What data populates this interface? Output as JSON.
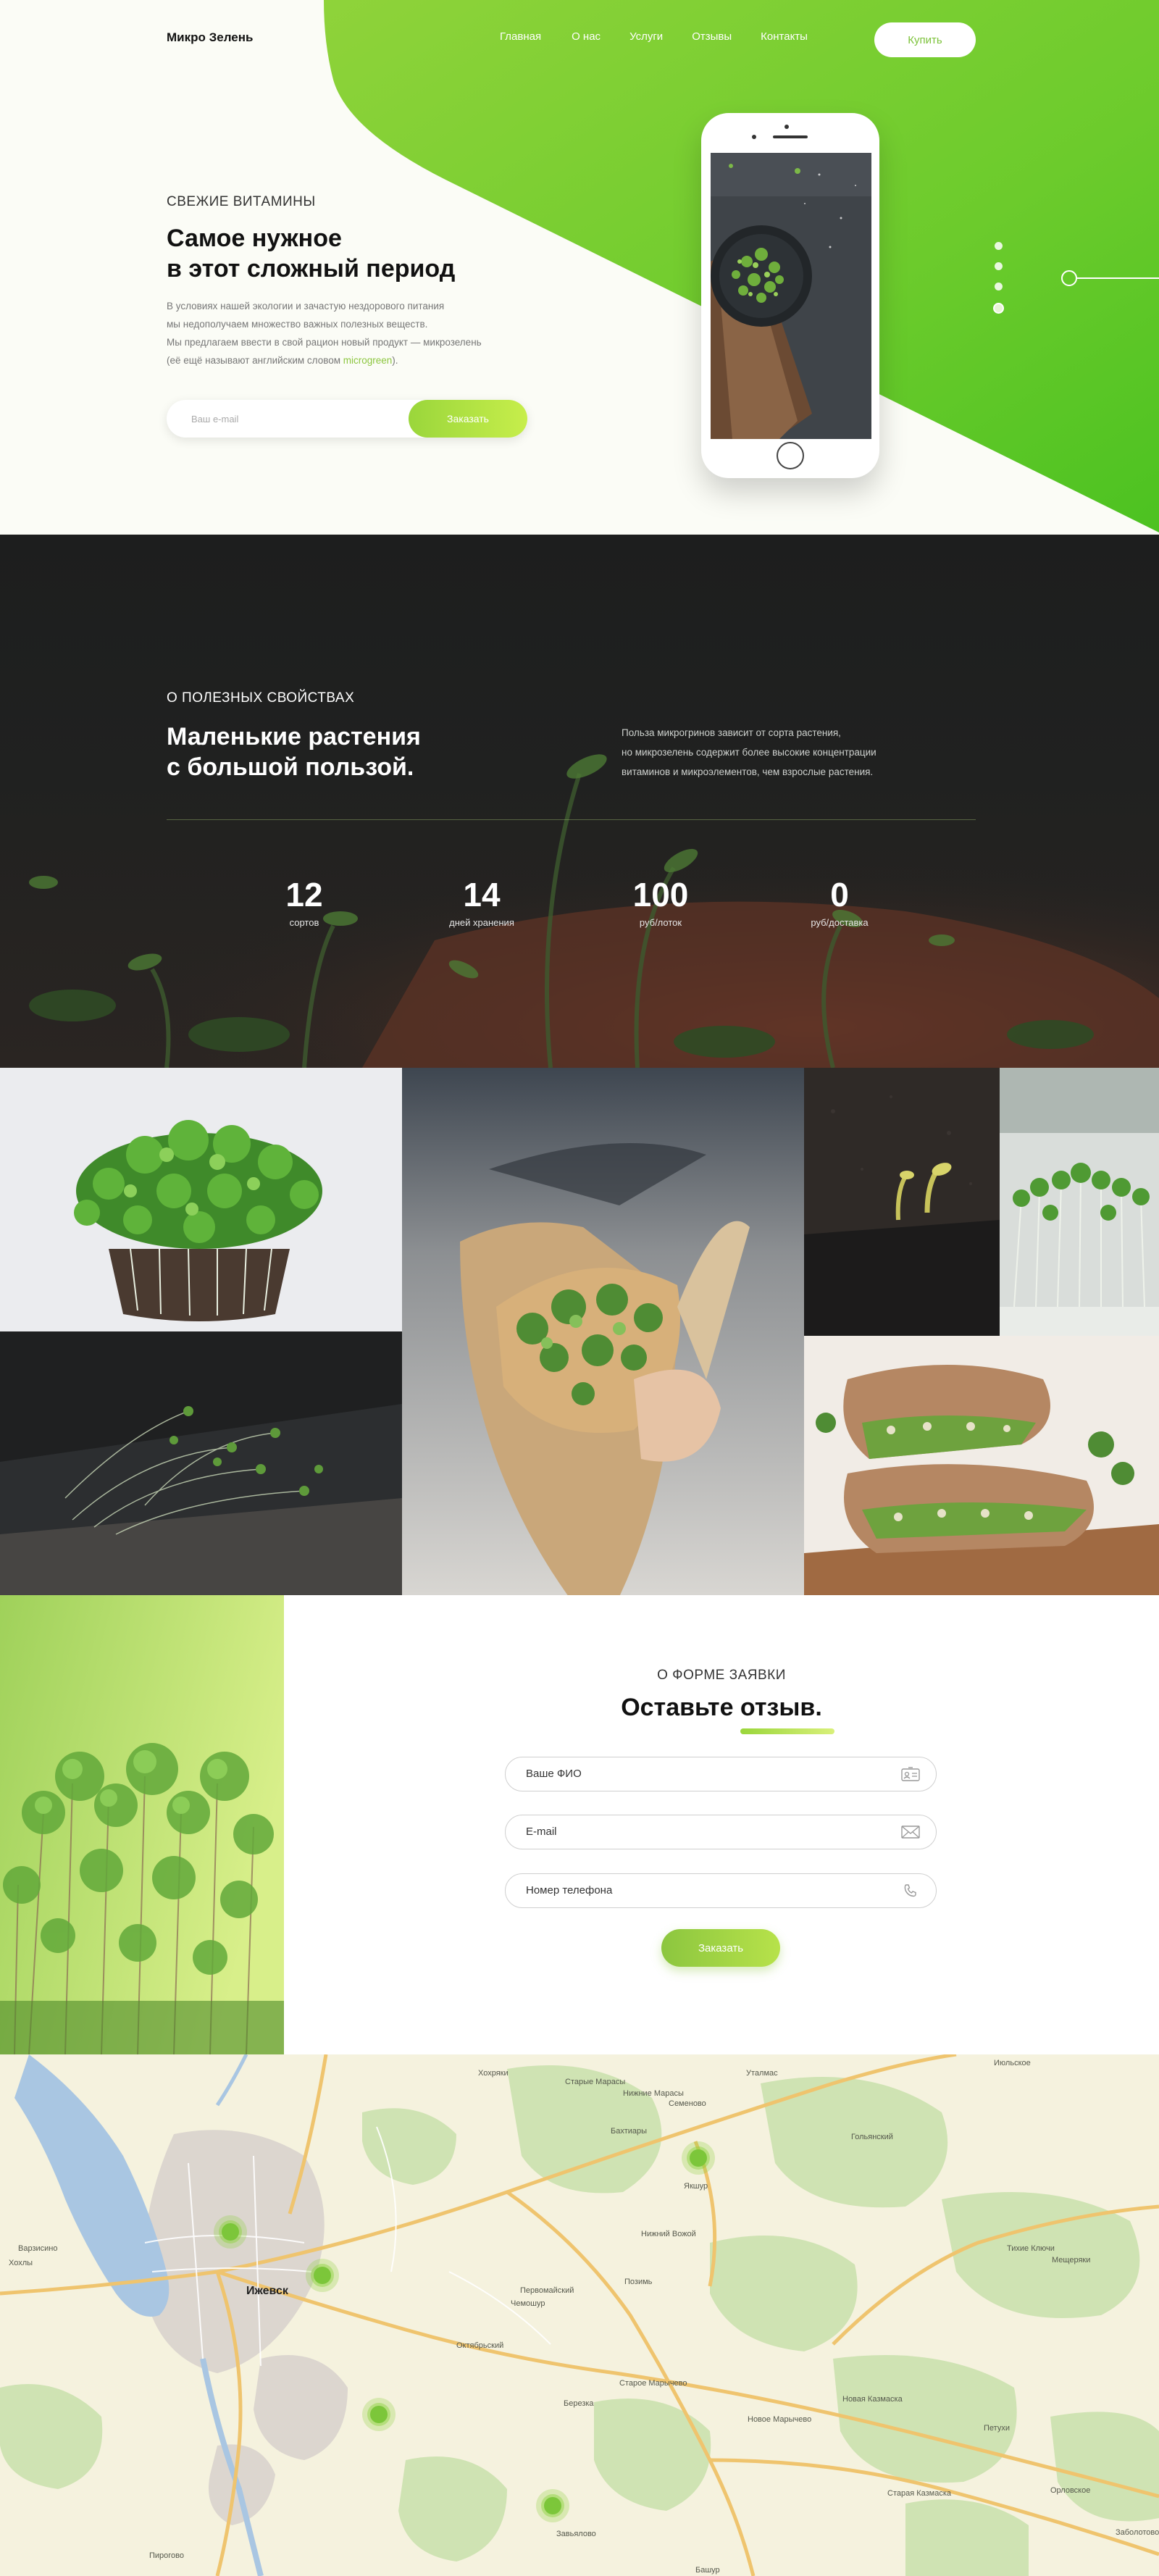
{
  "header": {
    "logo": "Микро Зелень",
    "nav": [
      "Главная",
      "О нас",
      "Услуги",
      "Отзывы",
      "Контакты"
    ],
    "buy_label": "Купить"
  },
  "hero": {
    "eyebrow": "СВЕЖИЕ ВИТАМИНЫ",
    "title_line1": "Самое нужное",
    "title_line2": "в этот сложный период",
    "desc_line1": "В условиях нашей экологии и зачастую нездорового питания",
    "desc_line2": "мы недополучаем множество важных полезных веществ.",
    "desc_line3": "Мы предлагаем ввести в свой рацион новый продукт — микрозелень",
    "desc_line4_prefix": "(её ещё называют английским словом ",
    "desc_line4_highlight": "microgreen",
    "desc_line4_suffix": ").",
    "email_placeholder": "Ваш e-mail",
    "order_label": "Заказать"
  },
  "about": {
    "eyebrow": "О ПОЛЕЗНЫХ СВОЙСТВАХ",
    "title_line1": "Маленькие растения",
    "title_line2": "с большой пользой.",
    "desc_line1": "Польза микрогринов зависит от сорта растения,",
    "desc_line2": "но микрозелень содержит более высокие концентрации",
    "desc_line3": "витаминов и микроэлементов, чем взрослые растения.",
    "stats": [
      {
        "value": "12",
        "label": "сортов"
      },
      {
        "value": "14",
        "label": "дней хранения"
      },
      {
        "value": "100",
        "label": "руб/лоток"
      },
      {
        "value": "0",
        "label": "руб/доставка"
      }
    ]
  },
  "form": {
    "eyebrow": "О ФОРМЕ ЗАЯВКИ",
    "title": "Оставьте отзыв.",
    "name_placeholder": "Ваше ФИО",
    "email_placeholder": "E-mail",
    "phone_placeholder": "Номер телефона",
    "submit_label": "Заказать"
  },
  "map": {
    "labels": [
      {
        "text": "Ижевск",
        "big": true
      },
      {
        "text": "Хохряки"
      },
      {
        "text": "Старые Марасы"
      },
      {
        "text": "Нижние Марасы"
      },
      {
        "text": "Уталмас"
      },
      {
        "text": "Семеново"
      },
      {
        "text": "Бахтиары"
      },
      {
        "text": "Якшур"
      },
      {
        "text": "Нижний Вожой"
      },
      {
        "text": "Первомайский"
      },
      {
        "text": "Чемошур"
      },
      {
        "text": "Позимь"
      },
      {
        "text": "Октябрьский"
      },
      {
        "text": "Старое Марычево"
      },
      {
        "text": "Новая Казмаска"
      },
      {
        "text": "Новое Марычево"
      },
      {
        "text": "Завьялово"
      },
      {
        "text": "Пирогово"
      },
      {
        "text": "Варзисино"
      },
      {
        "text": "Хохлы"
      },
      {
        "text": "Июльское"
      },
      {
        "text": "Гольянский"
      },
      {
        "text": "Тихие Ключи"
      },
      {
        "text": "Мещеряки"
      },
      {
        "text": "Петухи"
      },
      {
        "text": "Старая Казмаска"
      },
      {
        "text": "Орловское"
      },
      {
        "text": "Башур"
      },
      {
        "text": "Заболотово"
      },
      {
        "text": "Березка"
      }
    ]
  }
}
